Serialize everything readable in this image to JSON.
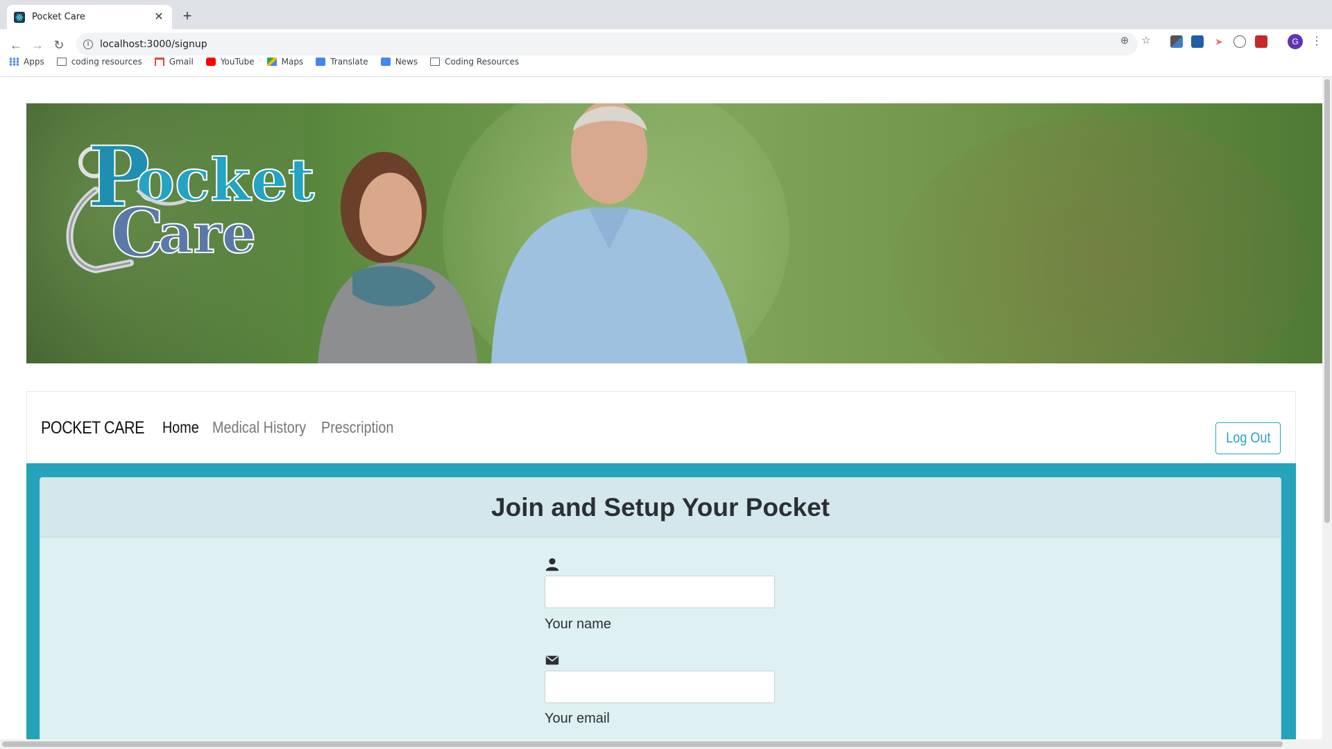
{
  "browser": {
    "tab_title": "Pocket Care",
    "tab_close": "✕",
    "new_tab": "+",
    "url": "localhost:3000/signup",
    "profile_initial": "G",
    "bookmarks": [
      {
        "label": "Apps",
        "icon": "apps-grid-icon"
      },
      {
        "label": "coding resources",
        "icon": "folder-icon"
      },
      {
        "label": "Gmail",
        "icon": "gmail-icon"
      },
      {
        "label": "YouTube",
        "icon": "youtube-icon"
      },
      {
        "label": "Maps",
        "icon": "maps-icon"
      },
      {
        "label": "Translate",
        "icon": "translate-icon"
      },
      {
        "label": "News",
        "icon": "news-icon"
      },
      {
        "label": "Coding Resources",
        "icon": "folder-icon"
      }
    ]
  },
  "hero": {
    "logo_text_line1": "ocket",
    "logo_text_line2": "are",
    "logo_initials": "P C"
  },
  "navbar": {
    "brand": "POCKET CARE",
    "links": [
      "Home",
      "Medical History",
      "Prescription"
    ],
    "active_link": "Home",
    "logout_label": "Log Out"
  },
  "form": {
    "title": "Join and Setup Your Pocket",
    "fields": [
      {
        "icon": "user-icon",
        "label": "Your name",
        "value": ""
      },
      {
        "icon": "envelope-icon",
        "label": "Your email",
        "value": ""
      }
    ]
  },
  "colors": {
    "accent": "#24a3ba",
    "card_bg": "#dff0f3",
    "header_bg": "#d3e7ec"
  }
}
